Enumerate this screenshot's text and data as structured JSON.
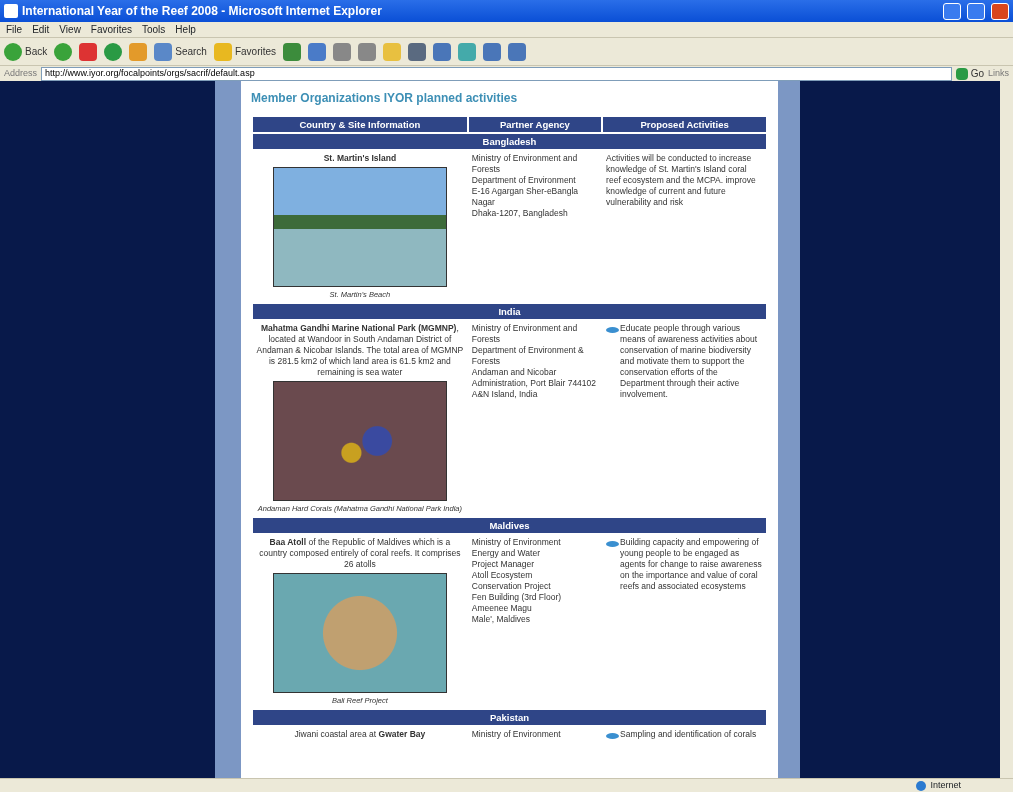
{
  "window": {
    "title": "International Year of the Reef 2008 - Microsoft Internet Explorer"
  },
  "menu": [
    "File",
    "Edit",
    "View",
    "Favorites",
    "Tools",
    "Help"
  ],
  "toolbar": [
    {
      "kind": "back",
      "label": "Back"
    },
    {
      "kind": "forward"
    },
    {
      "kind": "stop"
    },
    {
      "kind": "refresh"
    },
    {
      "kind": "home"
    },
    {
      "kind": "search",
      "label": "Search"
    },
    {
      "kind": "favorites",
      "label": "Favorites"
    },
    {
      "kind": "media"
    },
    {
      "kind": "mail"
    },
    {
      "kind": "print"
    },
    {
      "kind": "edit"
    },
    {
      "kind": "folder"
    },
    {
      "kind": "k"
    },
    {
      "kind": "tool"
    },
    {
      "kind": "messenger"
    },
    {
      "kind": "tool"
    },
    {
      "kind": "tool"
    }
  ],
  "address": {
    "label": "Address",
    "url": "http://www.iyor.org/focalpoints/orgs/sacrif/default.asp",
    "go": "Go",
    "links": "Links"
  },
  "page": {
    "heading": "Member Organizations IYOR planned activities",
    "columns": [
      "Country & Site Information",
      "Partner Agency",
      "Proposed Activities"
    ],
    "sections": [
      {
        "country": "Bangladesh",
        "site": "**St. Martin's Island**",
        "photo": {
          "kind": "beach",
          "caption": "St. Martin's Beach"
        },
        "agency": [
          "Ministry of Environment and Forests",
          "Department of Environment",
          "E-16 Agargan Sher-eBangla Nagar",
          "Dhaka-1207, Bangladesh"
        ],
        "activity": "Activities will be conducted to increase knowledge of St. Martin's Island coral reef ecosystem and the MCPA. improve knowledge of current and future vulnerability and risk",
        "bullet": false
      },
      {
        "country": "India",
        "site": "**Mahatma Gandhi Marine National Park (MGMNP)**, located at Wandoor in South Andaman District of Andaman & Nicobar Islands. The total area of MGMNP is 281.5 km2 of which land area is 61.5 km2 and remaining is sea water",
        "photo": {
          "kind": "reef",
          "caption": "Andaman Hard Corals (Mahatma Gandhi National Park India)"
        },
        "agency": [
          "Ministry of Environment and Forests",
          "Department of Environment & Forests",
          "Andaman and Nicobar Administration, Port Blair 744102",
          "A&N Island, India"
        ],
        "activity": "Educate people through various means of awareness activities about conservation of marine biodiversity and motivate them to support the conservation efforts of the Department through their active involvement.",
        "bullet": true
      },
      {
        "country": "Maldives",
        "site": "**Baa Atoll** of the Republic of Maldives which is a country composed entirely of coral reefs. It comprises 26 atolls",
        "photo": {
          "kind": "coral",
          "caption": "Bali Reef Project"
        },
        "agency": [
          "Ministry of Environment",
          "Energy and Water",
          "Project Manager",
          "Atoll Ecosystem",
          "Conservation Project",
          "Fen Building (3rd Floor)",
          "Ameenee Magu",
          "Male', Maldives"
        ],
        "activity": "Building capacity and empowering of young people to be engaged as agents for change to raise awareness on the importance and value of coral reefs and associated ecosystems",
        "bullet": true
      },
      {
        "country": "Pakistan",
        "site": "Jiwani coastal area at **Gwater Bay**",
        "agency": [
          "Ministry of Environment"
        ],
        "activity": "Sampling and identification of corals",
        "bullet": true
      }
    ]
  },
  "status_bar": {
    "zone": "Internet"
  }
}
